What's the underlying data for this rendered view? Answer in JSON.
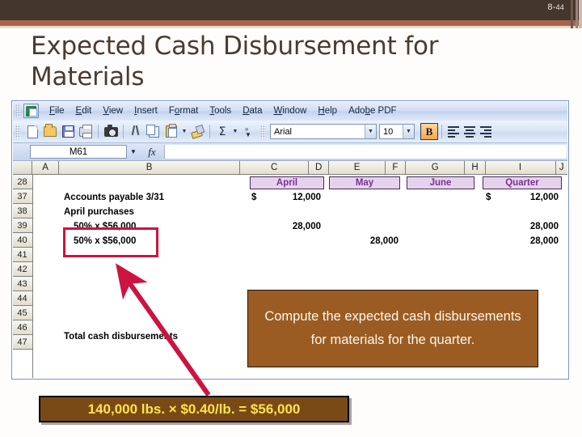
{
  "slide": {
    "number": "8-",
    "number_sub": "44",
    "title": "Expected Cash Disbursement for Materials"
  },
  "excel": {
    "menu": [
      {
        "label": "File",
        "hotkey": "F"
      },
      {
        "label": "Edit",
        "hotkey": "E"
      },
      {
        "label": "View",
        "hotkey": "V"
      },
      {
        "label": "Insert",
        "hotkey": "I"
      },
      {
        "label": "Format",
        "hotkey": "o"
      },
      {
        "label": "Tools",
        "hotkey": "T"
      },
      {
        "label": "Data",
        "hotkey": "D"
      },
      {
        "label": "Window",
        "hotkey": "W"
      },
      {
        "label": "Help",
        "hotkey": "H"
      },
      {
        "label": "Adobe PDF",
        "hotkey": "b"
      }
    ],
    "toolbar_icons": [
      "new-document-icon",
      "open-folder-icon",
      "save-icon",
      "print-icon",
      "camera-icon",
      "cut-icon",
      "copy-icon",
      "paste-icon",
      "format-painter-icon",
      "autosum-icon",
      "more-buttons-icon"
    ],
    "font_name": "Arial",
    "font_size": "10",
    "bold_label": "B",
    "bold_active": true,
    "name_box": "M61",
    "formula_value": "",
    "fx_label": "fx",
    "columns": [
      "A",
      "B",
      "C",
      "D",
      "E",
      "F",
      "G",
      "H",
      "I",
      "J"
    ],
    "rows": [
      "28",
      "37",
      "38",
      "39",
      "40",
      "41",
      "42",
      "43",
      "44",
      "45",
      "46",
      "47"
    ],
    "period_headers": [
      "April",
      "May",
      "June",
      "Quarter"
    ],
    "header_color": "#7b2f8f",
    "header_fill": "#e5d3ee",
    "labels": {
      "accounts_payable": "Accounts payable 3/31",
      "april_purchases": "April purchases",
      "line_39": "50% x $56,000",
      "line_40": "50% x $56,000",
      "total": "Total cash disbursements"
    },
    "values": {
      "ap_april_sym": "$",
      "ap_april": "12,000",
      "ap_quarter_sym": "$",
      "ap_quarter": "12,000",
      "r39_april": "28,000",
      "r39_quarter": "28,000",
      "r40_may": "28,000",
      "r40_quarter": "28,000"
    }
  },
  "annotations": {
    "highlight_box_color": "#cc1441",
    "arrow_color": "#cc1441",
    "callout_main": "Compute the expected cash disbursements for materials for the quarter.",
    "callout_bottom": "140,000 lbs. × $0.40/lb. = $56,000"
  }
}
